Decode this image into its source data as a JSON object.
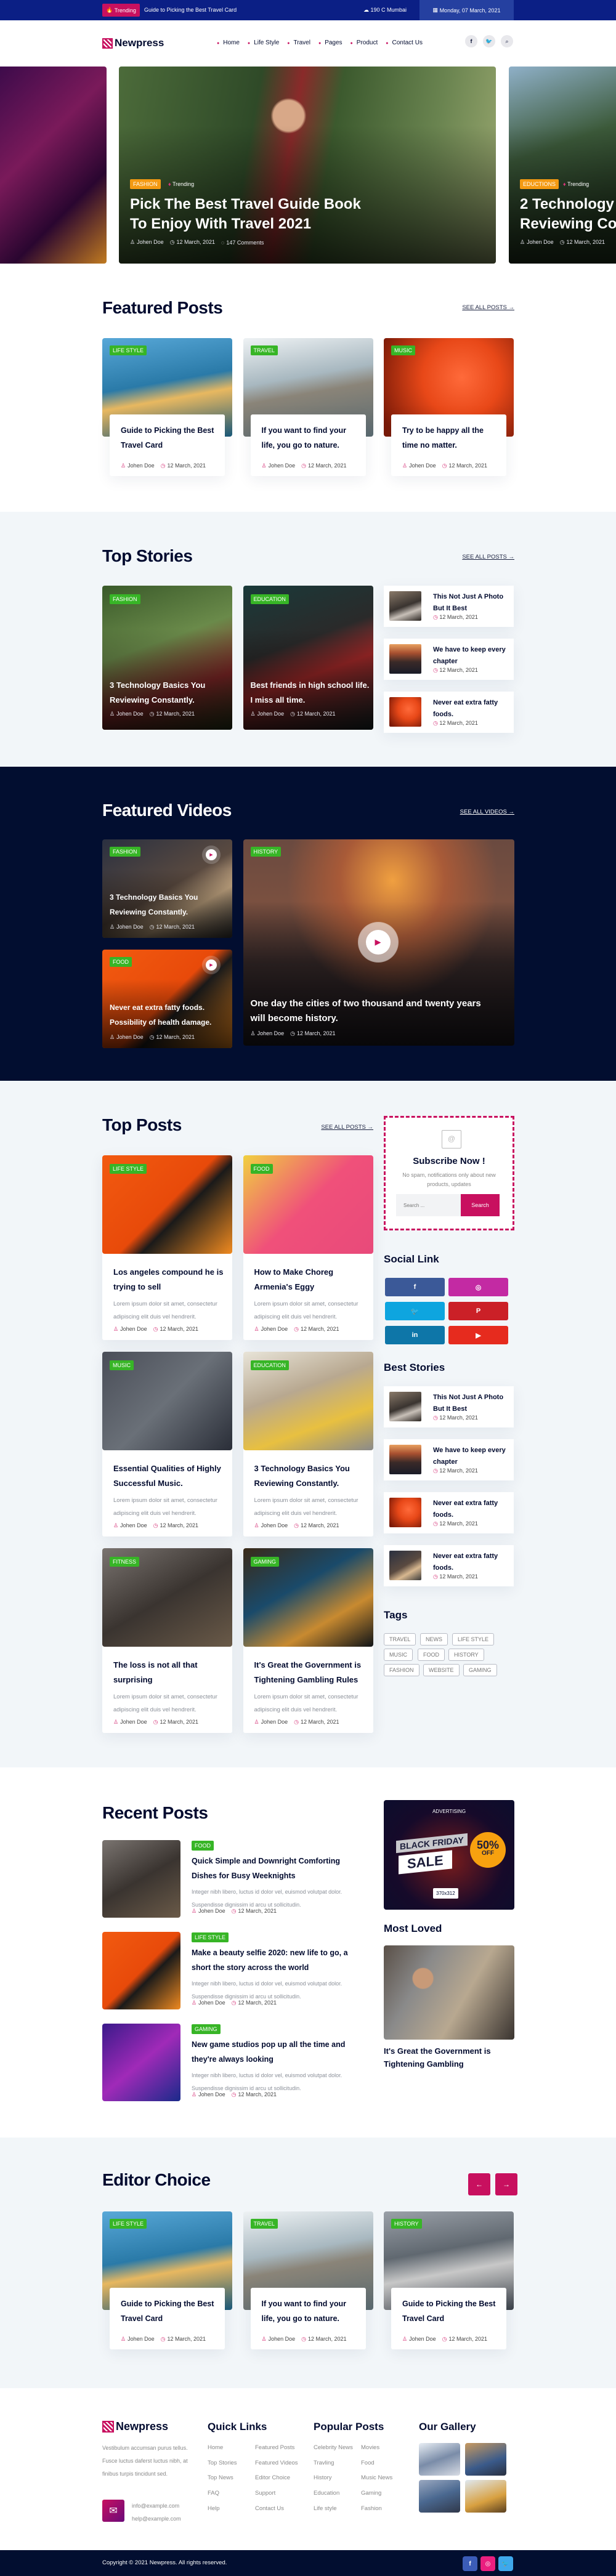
{
  "colors": {
    "topbar": "#0b1f85",
    "accent": "#c8105f",
    "dark": "#020e30",
    "tag_green": "#37b526",
    "tag_orange": "#f49a12",
    "light_bg": "#f2f6f9"
  },
  "topbar": {
    "trending_label": "Trending",
    "trending_text": "Guide to Picking the Best Travel Card",
    "weather": "190 C Mumbai",
    "date": "Monday, 07 March, 2021"
  },
  "nav": {
    "logo": "Newpress",
    "items": [
      "Home",
      "Life Style",
      "Travel",
      "Pages",
      "Product",
      "Contact Us"
    ],
    "icons": [
      "facebook-icon",
      "twitter-icon",
      "search-icon"
    ]
  },
  "hero": {
    "slides": [
      {
        "tag": "FASHION",
        "trending": "Trending",
        "title": "Pick The Best Travel Guide Book To Enjoy With Travel 2021",
        "author": "Johen Doe",
        "date": "12 March, 2021",
        "comments": "147 Comments"
      },
      {
        "tag": "EDUCTIONS",
        "trending": "Trending",
        "title": "2 Technology Reviewing Co",
        "author": "Johen Doe",
        "date": "12 March, 2021"
      }
    ]
  },
  "featured": {
    "title": "Featured Posts",
    "see_all": "SEE ALL POSTS →",
    "cards": [
      {
        "tag": "LIFE STYLE",
        "title": "Guide to Picking the Best Travel Card",
        "author": "Johen Doe",
        "date": "12 March, 2021"
      },
      {
        "tag": "TRAVEL",
        "title": "If you want to find your life, you go to nature.",
        "author": "Johen Doe",
        "date": "12 March, 2021"
      },
      {
        "tag": "MUSIC",
        "title": "Try to be happy all the time no matter.",
        "author": "Johen Doe",
        "date": "12 March, 2021"
      }
    ]
  },
  "top_stories": {
    "title": "Top Stories",
    "see_all": "SEE ALL POSTS →",
    "big": [
      {
        "tag": "FASHION",
        "title": "3 Technology Basics You Reviewing Constantly.",
        "author": "Johen Doe",
        "date": "12 March, 2021"
      },
      {
        "tag": "EDUCATION",
        "title": "Best friends in high school life. I miss all time.",
        "author": "Johen Doe",
        "date": "12 March, 2021"
      }
    ],
    "side": [
      {
        "title": "This Not Just A Photo But It Best",
        "date": "12 March, 2021"
      },
      {
        "title": "We have to keep every chapter",
        "date": "12 March, 2021"
      },
      {
        "title": "Never eat extra fatty foods.",
        "date": "12 March, 2021"
      }
    ]
  },
  "videos": {
    "title": "Featured Videos",
    "see_all": "SEE ALL VIDEOS →",
    "small": [
      {
        "tag": "FASHION",
        "title": "3 Technology Basics You Reviewing Constantly.",
        "author": "Johen Doe",
        "date": "12 March, 2021"
      },
      {
        "tag": "FOOD",
        "title": "Never eat extra fatty foods. Possibility of health damage.",
        "author": "Johen Doe",
        "date": "12 March, 2021"
      }
    ],
    "big": {
      "tag": "HISTORY",
      "title": "One day the cities of two thousand and twenty years will become history.",
      "author": "Johen Doe",
      "date": "12 March, 2021"
    }
  },
  "top_posts": {
    "title": "Top Posts",
    "see_all": "SEE ALL POSTS →",
    "cards": [
      {
        "tag": "LIFE STYLE",
        "title": "Los angeles compound he is trying to sell",
        "excerpt": "Lorem ipsum dolor sit amet, consectetur adipiscing elit duis vel hendrerit.",
        "author": "Johen Doe",
        "date": "12 March, 2021"
      },
      {
        "tag": "FOOD",
        "title": "How to Make Choreg Armenia's Eggy",
        "excerpt": "Lorem ipsum dolor sit amet, consectetur adipiscing elit duis vel hendrerit.",
        "author": "Johen Doe",
        "date": "12 March, 2021"
      },
      {
        "tag": "MUSIC",
        "title": "Essential Qualities of Highly Successful Music.",
        "excerpt": "Lorem ipsum dolor sit amet, consectetur adipiscing elit duis vel hendrerit.",
        "author": "Johen Doe",
        "date": "12 March, 2021"
      },
      {
        "tag": "EDUCATION",
        "title": "3 Technology Basics You Reviewing Constantly.",
        "excerpt": "Lorem ipsum dolor sit amet, consectetur adipiscing elit duis vel hendrerit.",
        "author": "Johen Doe",
        "date": "12 March, 2021"
      },
      {
        "tag": "FITNESS",
        "title": "The loss is not all that surprising",
        "excerpt": "Lorem ipsum dolor sit amet, consectetur adipiscing elit duis vel hendrerit.",
        "author": "Johen Doe",
        "date": "12 March, 2021"
      },
      {
        "tag": "GAMING",
        "title": "It's Great the Government is Tightening Gambling Rules",
        "excerpt": "Lorem ipsum dolor sit amet, consectetur adipiscing elit duis vel hendrerit.",
        "author": "Johen Doe",
        "date": "12 March, 2021"
      }
    ]
  },
  "sidebar": {
    "subscribe": {
      "title": "Subscribe Now !",
      "text": "No spam, notifications only about new products, updates",
      "placeholder": "Search ...",
      "button": "Search"
    },
    "social_title": "Social Link",
    "social": [
      {
        "icon": "facebook-icon",
        "color": "#3b5998"
      },
      {
        "icon": "instagram-icon",
        "color": "#c32aa3"
      },
      {
        "icon": "twitter-icon",
        "color": "#0ea5df"
      },
      {
        "icon": "pinterest-icon",
        "color": "#cb2027"
      },
      {
        "icon": "linkedin-icon",
        "color": "#0e76a8"
      },
      {
        "icon": "youtube-icon",
        "color": "#e62b1e"
      }
    ],
    "best_title": "Best Stories",
    "best": [
      {
        "title": "This Not Just A Photo But It Best",
        "date": "12 March, 2021"
      },
      {
        "title": "We have to keep every chapter",
        "date": "12 March, 2021"
      },
      {
        "title": "Never eat extra fatty foods.",
        "date": "12 March, 2021"
      },
      {
        "title": "Never eat extra fatty foods.",
        "date": "12 March, 2021"
      }
    ],
    "tags_title": "Tags",
    "tags": [
      "TRAVEL",
      "NEWS",
      "LIFE STYLE",
      "MUSIC",
      "FOOD",
      "HISTORY",
      "FASHION",
      "WEBSITE",
      "GAMING"
    ]
  },
  "recent": {
    "title": "Recent Posts",
    "items": [
      {
        "tag": "FOOD",
        "title": "Quick Simple and Downright Comforting Dishes for Busy Weeknights",
        "excerpt": "Integer nibh libero, luctus id dolor vel, euismod volutpat dolor. Suspendisse dignissim id arcu ut sollicitudin.",
        "author": "Johen Doe",
        "date": "12 March, 2021"
      },
      {
        "tag": "LIFE STYLE",
        "title": "Make a beauty selfie 2020: new life to go, a short the story across the world",
        "excerpt": "Integer nibh libero, luctus id dolor vel, euismod volutpat dolor. Suspendisse dignissim id arcu ut sollicitudin.",
        "author": "Johen Doe",
        "date": "12 March, 2021"
      },
      {
        "tag": "GAMING",
        "title": "New game studios pop up all the time and they're always looking",
        "excerpt": "Integer nibh libero, luctus id dolor vel, euismod volutpat dolor. Suspendisse dignissim id arcu ut sollicitudin.",
        "author": "Johen Doe",
        "date": "12 March, 2021"
      }
    ],
    "ad": {
      "label": "ADVERTISING",
      "line1": "BLACK FRIDAY",
      "line2": "SALE",
      "badge_big": "50%",
      "badge_small": "OFF",
      "size": "370x312"
    },
    "most_loved": {
      "title": "Most Loved",
      "post_title": "It's Great the Government is Tightening Gambling"
    }
  },
  "editor": {
    "title": "Editor Choice",
    "cards": [
      {
        "tag": "LIFE STYLE",
        "title": "Guide to Picking the Best Travel Card",
        "author": "Johen Doe",
        "date": "12 March, 2021"
      },
      {
        "tag": "TRAVEL",
        "title": "If you want to find your life, you go to nature.",
        "author": "Johen Doe",
        "date": "12 March, 2021"
      },
      {
        "tag": "HISTORY",
        "title": "Guide to Picking the Best Travel Card",
        "author": "Johen Doe",
        "date": "12 March, 2021"
      }
    ]
  },
  "footer": {
    "logo": "Newpress",
    "about": "Vestibulum accumsan purus tellus. Fusce luctus daferst luctus nibh, at finibus turpis tincidunt sed.",
    "emails": [
      "info@example.com",
      "help@example.com"
    ],
    "quick_title": "Quick Links",
    "quick": [
      "Home",
      "Featured Posts",
      "Top Stories",
      "Featured Videos",
      "Top News",
      "Editor Choice",
      "FAQ",
      "Support",
      "Help",
      "Contact Us"
    ],
    "popular_title": "Popular Posts",
    "popular": [
      "Celebrity News",
      "Movies",
      "Travling",
      "Food",
      "History",
      "Music News",
      "Education",
      "Gaming",
      "Life style",
      "Fashion"
    ],
    "gallery_title": "Our Gallery",
    "copyright": "Copyright © 2021 Newpress. All rights reserved.",
    "social": [
      "facebook-icon",
      "instagram-icon",
      "twitter-icon"
    ]
  }
}
